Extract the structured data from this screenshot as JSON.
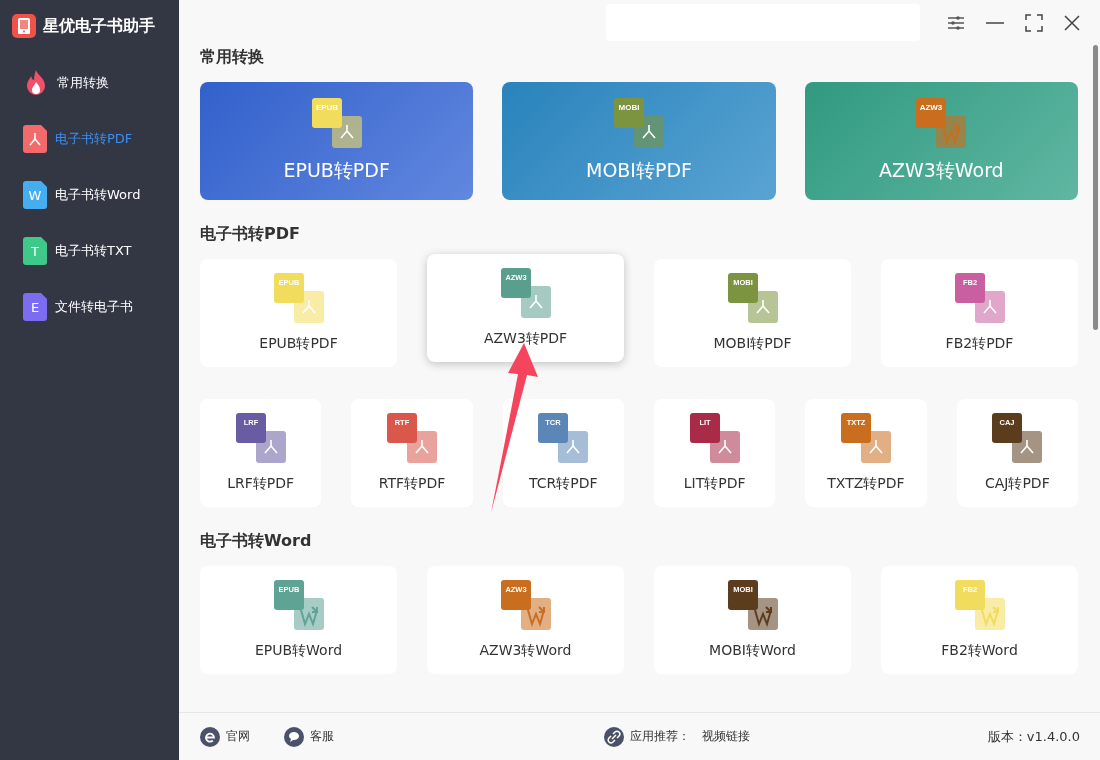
{
  "app": {
    "title": "星优电子书助手"
  },
  "sidebar": {
    "items": [
      {
        "label": "常用转换",
        "kind": "fire",
        "selected": false
      },
      {
        "label": "电子书转PDF",
        "kind": "pdf",
        "selected": true
      },
      {
        "label": "电子书转Word",
        "kind": "letter",
        "glyph": "W",
        "color": "#45aef0",
        "selected": false
      },
      {
        "label": "电子书转TXT",
        "kind": "letter",
        "glyph": "T",
        "color": "#3ec98a",
        "selected": false
      },
      {
        "label": "文件转电子书",
        "kind": "letter",
        "glyph": "E",
        "color": "#7b6cf0",
        "selected": false
      }
    ]
  },
  "sections": [
    {
      "title": "常用转换",
      "kind": "featured",
      "cards": [
        {
          "label": "EPUB转PDF",
          "icon": {
            "badge": "EPUB",
            "kind": "pdf",
            "color": "#f2dc5d"
          },
          "color": "#3566d6"
        },
        {
          "label": "MOBI转PDF",
          "icon": {
            "badge": "MOBI",
            "kind": "pdf",
            "color": "#7c9440"
          },
          "color": "#2b8ac6"
        },
        {
          "label": "AZW3转Word",
          "icon": {
            "badge": "AZW3",
            "kind": "word",
            "color": "#c96e1e"
          },
          "color": "#33a287"
        }
      ]
    },
    {
      "title": "电子书转PDF",
      "kind": "grid",
      "rows": [
        [
          {
            "label": "EPUB转PDF",
            "icon": {
              "badge": "EPUB",
              "kind": "pdf",
              "color": "#f2dc5d"
            },
            "selected": false
          },
          {
            "label": "AZW3转PDF",
            "icon": {
              "badge": "AZW3",
              "kind": "pdf",
              "color": "#5a9e8e"
            },
            "selected": true
          },
          {
            "label": "MOBI转PDF",
            "icon": {
              "badge": "MOBI",
              "kind": "pdf",
              "color": "#7c9440"
            },
            "selected": false
          },
          {
            "label": "FB2转PDF",
            "icon": {
              "badge": "FB2",
              "kind": "pdf",
              "color": "#c95fa0"
            },
            "selected": false
          }
        ],
        [
          {
            "label": "LRF转PDF",
            "icon": {
              "badge": "LRF",
              "kind": "pdf",
              "color": "#6a5ca3"
            },
            "selected": false
          },
          {
            "label": "RTF转PDF",
            "icon": {
              "badge": "RTF",
              "kind": "pdf",
              "color": "#d9574b"
            },
            "selected": false
          },
          {
            "label": "TCR转PDF",
            "icon": {
              "badge": "TCR",
              "kind": "pdf",
              "color": "#5b86b5"
            },
            "selected": false
          },
          {
            "label": "LIT转PDF",
            "icon": {
              "badge": "LIT",
              "kind": "pdf",
              "color": "#a92b48"
            },
            "selected": false
          },
          {
            "label": "TXTZ转PDF",
            "icon": {
              "badge": "TXTZ",
              "kind": "pdf",
              "color": "#c96e1e"
            },
            "selected": false
          },
          {
            "label": "CAJ转PDF",
            "icon": {
              "badge": "CAJ",
              "kind": "pdf",
              "color": "#5b3d1d"
            },
            "selected": false
          }
        ]
      ]
    },
    {
      "title": "电子书转Word",
      "kind": "grid",
      "rows": [
        [
          {
            "label": "EPUB转Word",
            "icon": {
              "badge": "EPUB",
              "kind": "word",
              "color": "#5fa395"
            },
            "selected": false
          },
          {
            "label": "AZW3转Word",
            "icon": {
              "badge": "AZW3",
              "kind": "word",
              "color": "#c96e1e"
            },
            "selected": false
          },
          {
            "label": "MOBI转Word",
            "icon": {
              "badge": "MOBI",
              "kind": "word",
              "color": "#5b3d1d"
            },
            "selected": false
          },
          {
            "label": "FB2转Word",
            "icon": {
              "badge": "FB2",
              "kind": "word",
              "color": "#f2dc5d"
            },
            "selected": false
          }
        ]
      ]
    }
  ],
  "footer": {
    "links": [
      {
        "label": "官网",
        "kind": "web"
      },
      {
        "label": "客服",
        "kind": "chat"
      }
    ],
    "recommend_label": "应用推荐：",
    "recommend_link": "视频链接",
    "version": "版本：v1.4.0.0"
  }
}
